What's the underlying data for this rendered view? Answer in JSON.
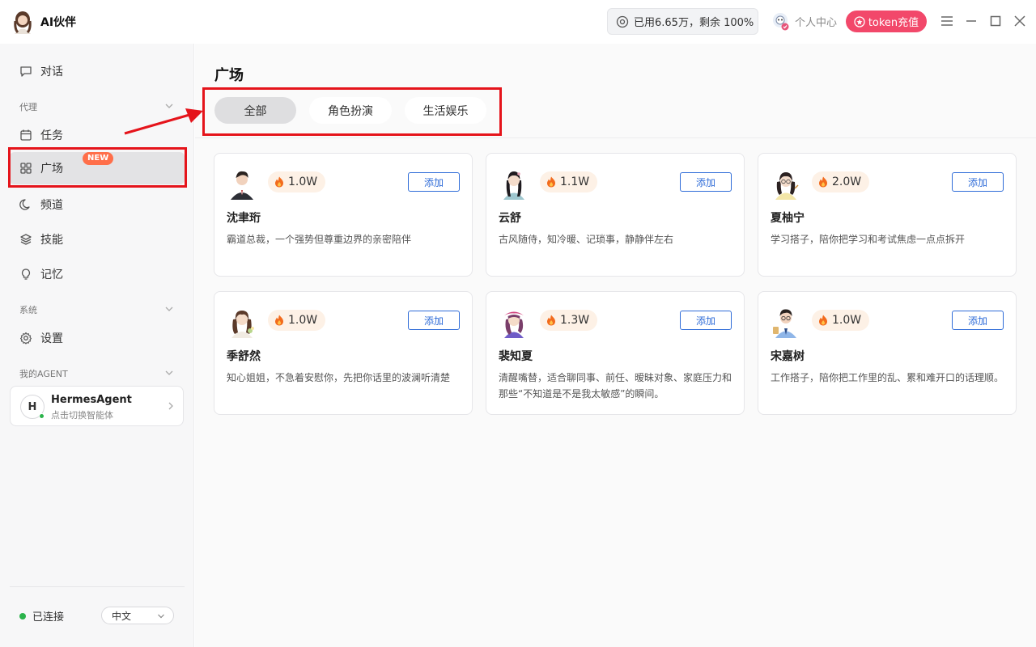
{
  "app": {
    "title": "AI伙伴"
  },
  "header": {
    "usage_text": "已用6.65万，剩余 100%",
    "user_center": "个人中心",
    "token_button": "token充值"
  },
  "sidebar": {
    "chat": "对话",
    "group_agent": "代理",
    "tasks": "任务",
    "plaza": "广场",
    "plaza_badge": "NEW",
    "channels": "频道",
    "skills": "技能",
    "memory": "记忆",
    "group_system": "系统",
    "settings": "设置",
    "group_my_agent": "我的AGENT",
    "agent": {
      "initial": "H",
      "name": "HermesAgent",
      "subtitle": "点击切换智能体"
    },
    "connection_status": "已连接",
    "language": "中文"
  },
  "main": {
    "title": "广场",
    "tabs": [
      {
        "label": "全部",
        "active": true
      },
      {
        "label": "角色扮演",
        "active": false
      },
      {
        "label": "生活娱乐",
        "active": false
      }
    ],
    "cards": [
      {
        "name": "沈聿珩",
        "hot": "1.0W",
        "add": "添加",
        "desc": "霸道总裁，一个强势但尊重边界的亲密陪伴"
      },
      {
        "name": "云舒",
        "hot": "1.1W",
        "add": "添加",
        "desc": "古风随侍，知冷暖、记琐事，静静伴左右"
      },
      {
        "name": "夏柚宁",
        "hot": "2.0W",
        "add": "添加",
        "desc": "学习搭子，陪你把学习和考试焦虑一点点拆开"
      },
      {
        "name": "季舒然",
        "hot": "1.0W",
        "add": "添加",
        "desc": "知心姐姐，不急着安慰你，先把你话里的波澜听清楚"
      },
      {
        "name": "裴知夏",
        "hot": "1.3W",
        "add": "添加",
        "desc": "清醒嘴替，适合聊同事、前任、暧昧对象、家庭压力和那些“不知道是不是我太敏感”的瞬间。"
      },
      {
        "name": "宋嘉树",
        "hot": "1.0W",
        "add": "添加",
        "desc": "工作搭子，陪你把工作里的乱、累和难开口的话理顺。"
      }
    ]
  },
  "colors": {
    "accent": "#2f6cd8",
    "token": "#f2486a",
    "annotation": "#e5141b",
    "online": "#2bb34b"
  }
}
